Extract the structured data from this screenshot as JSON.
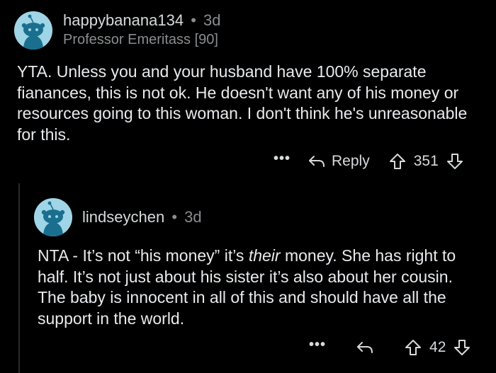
{
  "comment": {
    "username": "happybanana134",
    "separator": "•",
    "age": "3d",
    "flair": "Professor Emeritass [90]",
    "body": "YTA. Unless you and your husband have 100% separate fianances, this is not ok. He doesn't want any of his money or resources going to this woman. I don't think he's unreasonable for this.",
    "more_label": "•••",
    "reply_label": "Reply",
    "score": "351"
  },
  "reply": {
    "username": "lindseychen",
    "separator": "•",
    "age": "3d",
    "body_before": "NTA - It’s not “his money” it’s ",
    "body_emphasis": "their",
    "body_after": " money. She has right to half. It’s not just about his sister it’s also about her cousin. The baby is innocent in all of this and should have all the support in the world.",
    "more_label": "•••",
    "score": "42"
  },
  "colors": {
    "background": "#000000",
    "text": "#d7dadc",
    "muted": "#8a8d90",
    "avatar": "#9fd5e6"
  },
  "icons": {
    "avatar": "snoo-avatar-icon",
    "reply": "reply-arrow-icon",
    "upvote": "upvote-arrow-icon",
    "downvote": "downvote-arrow-icon"
  }
}
